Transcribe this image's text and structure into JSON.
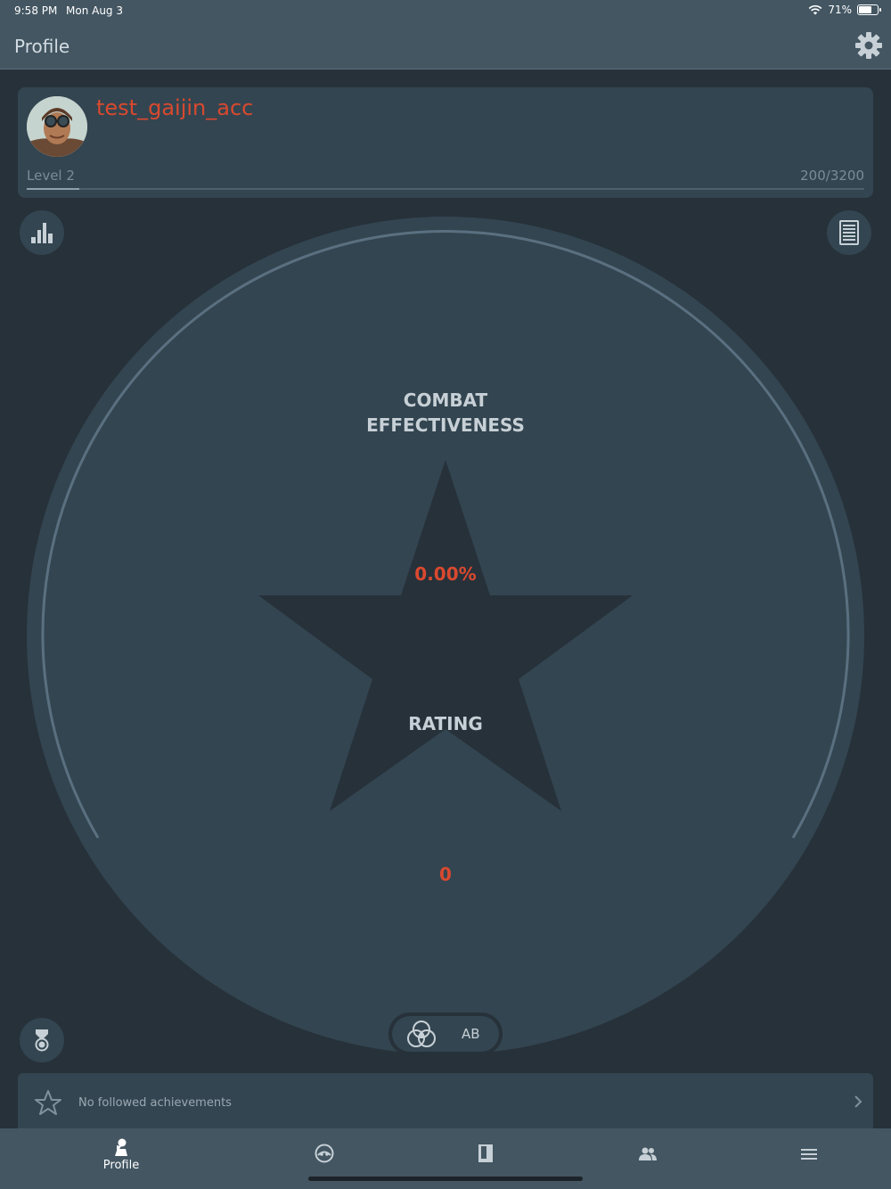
{
  "status_bar": {
    "time": "9:58 PM",
    "date": "Mon Aug 3",
    "battery": "71%"
  },
  "header": {
    "title": "Profile",
    "settings_icon": "gear-icon"
  },
  "profile": {
    "username": "test_gaijin_acc",
    "level_label": "Level 2",
    "xp_text": "200/3200",
    "xp_progress": 0.0625
  },
  "stats": {
    "combat_effectiveness_label": "COMBAT\nEFFECTIVENESS",
    "combat_effectiveness_value": "0.00%",
    "rating_label": "RATING",
    "rating_value": "0"
  },
  "mode_selector": {
    "mode": "AB",
    "icon": "combined-forces-icon"
  },
  "achievements": {
    "text": "No followed achievements"
  },
  "tabs": [
    {
      "label": "Profile",
      "icon": "pilot-icon",
      "active": true
    },
    {
      "label": "",
      "icon": "aircraft-badge-icon"
    },
    {
      "label": "",
      "icon": "book-icon"
    },
    {
      "label": "",
      "icon": "friends-icon"
    },
    {
      "label": "",
      "icon": "menu-icon"
    }
  ],
  "colors": {
    "accent": "#d9492f",
    "nav_bg": "#435662",
    "card_bg": "#334550",
    "page_bg": "#26313a"
  }
}
